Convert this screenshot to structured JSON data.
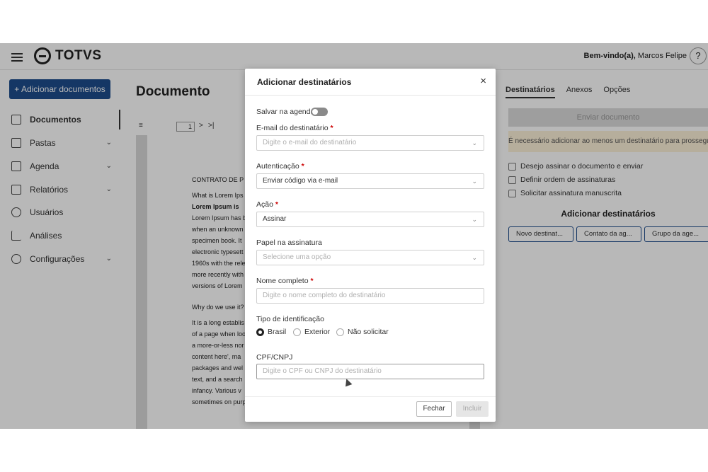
{
  "header": {
    "logo": "TOTVS",
    "welcome_prefix": "Bem-vindo(a),",
    "user": "Marcos Felipe",
    "help": "?"
  },
  "sidebar": {
    "add_button": "+ Adicionar documentos",
    "items": [
      {
        "label": "Documentos",
        "icon": "document-icon"
      },
      {
        "label": "Pastas",
        "icon": "folder-icon"
      },
      {
        "label": "Agenda",
        "icon": "contacts-icon"
      },
      {
        "label": "Relatórios",
        "icon": "report-icon"
      },
      {
        "label": "Usuários",
        "icon": "user-icon"
      },
      {
        "label": "Análises",
        "icon": "chart-icon"
      },
      {
        "label": "Configurações",
        "icon": "gear-icon"
      }
    ]
  },
  "main": {
    "title": "Documento",
    "page": "1",
    "paper_lines": [
      "CONTRATO DE P",
      "What is Lorem Ips",
      "Lorem Ipsum is",
      "Lorem Ipsum has b",
      "when an unknown",
      "specimen book. It",
      "electronic typesett",
      "1960s with the rele",
      "more recently with",
      "versions of Lorem",
      "Why do we use it?",
      "It is a long establis",
      "of a page when loo",
      "a more-or-less nor",
      "content here', ma",
      "packages and wel",
      "text, and a search",
      "infancy. Various v",
      "sometimes on purp"
    ]
  },
  "right_panel": {
    "tabs": [
      "Destinatários",
      "Anexos",
      "Opções"
    ],
    "send_button": "Enviar documento",
    "warning": "É necessário adicionar ao menos um destinatário para prosseguir",
    "checkboxes": [
      "Desejo assinar o documento e enviar",
      "Definir ordem de assinaturas",
      "Solicitar assinatura manuscrita"
    ],
    "add_title": "Adicionar destinatários",
    "buttons": [
      "Novo destinat...",
      "Contato da ag...",
      "Grupo da age..."
    ]
  },
  "modal": {
    "title": "Adicionar destinatários",
    "close": "×",
    "save_agenda": "Salvar na agenda",
    "email_label": "E-mail do destinatário",
    "email_placeholder": "Digite o e-mail do destinatário",
    "auth_label": "Autenticação",
    "auth_value": "Enviar código via e-mail",
    "action_label": "Ação",
    "action_value": "Assinar",
    "role_label": "Papel na assinatura",
    "role_placeholder": "Selecione uma opção",
    "name_label": "Nome completo",
    "name_placeholder": "Digite o nome completo do destinatário",
    "idtype_label": "Tipo de identificação",
    "idtype_options": [
      "Brasil",
      "Exterior",
      "Não solicitar"
    ],
    "idtype_selected": "Brasil",
    "cpf_label": "CPF/CNPJ",
    "cpf_placeholder": "Digite o CPF ou CNPJ do destinatário",
    "cancel": "Fechar",
    "include": "Incluir"
  }
}
